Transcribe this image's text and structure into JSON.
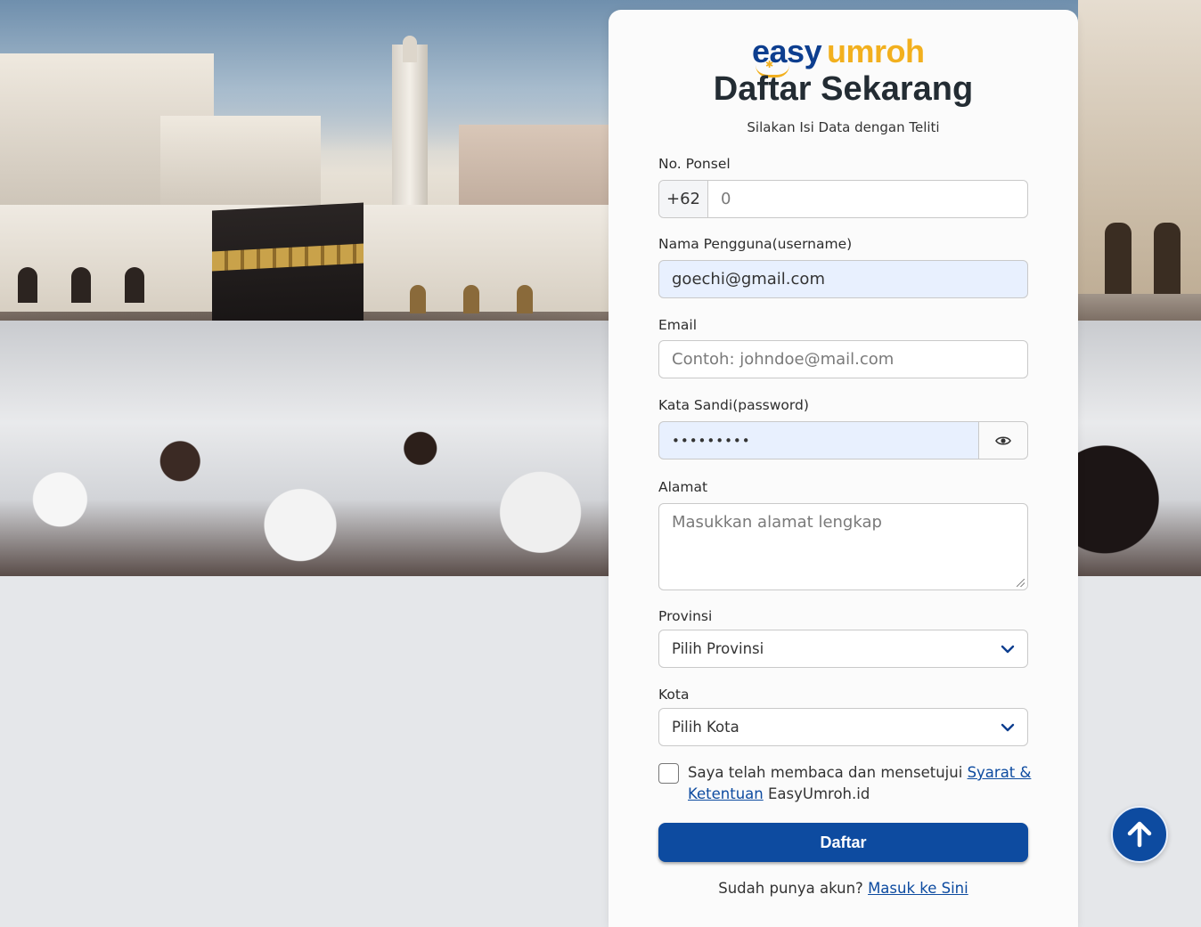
{
  "brand": {
    "logo_part1": "easy",
    "logo_part2": "umroh",
    "primary_color": "#0d4ba0",
    "accent_color": "#f2b01e"
  },
  "header": {
    "title": "Daftar Sekarang",
    "subtitle": "Silakan Isi Data dengan Teliti"
  },
  "form": {
    "phone": {
      "label": "No. Ponsel",
      "prefix": "+62",
      "placeholder": "0",
      "value": ""
    },
    "username": {
      "label": "Nama Pengguna(username)",
      "value": "goechi@gmail.com"
    },
    "email": {
      "label": "Email",
      "placeholder": "Contoh: johndoe@mail.com",
      "value": ""
    },
    "password": {
      "label": "Kata Sandi(password)",
      "value": "•••••••••",
      "toggle_icon": "eye-icon"
    },
    "address": {
      "label": "Alamat",
      "placeholder": "Masukkan alamat lengkap"
    },
    "province": {
      "label": "Provinsi",
      "selected": "Pilih Provinsi"
    },
    "city": {
      "label": "Kota",
      "selected": "Pilih Kota"
    },
    "terms": {
      "text_before": "Saya telah membaca dan mensetujui ",
      "link": "Syarat & Ketentuan",
      "text_after": " EasyUmroh.id",
      "checked": false
    },
    "submit_label": "Daftar"
  },
  "footer": {
    "login_prompt": "Sudah punya akun? ",
    "login_link": "Masuk ke Sini"
  },
  "scroll_top": {
    "icon": "arrow-up-icon"
  }
}
